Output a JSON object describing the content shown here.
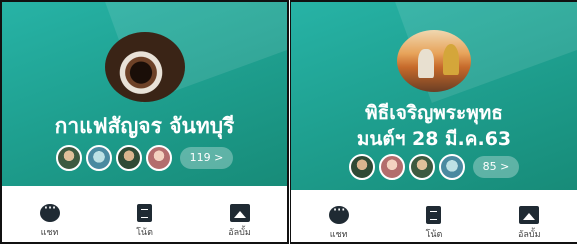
{
  "left": {
    "title": "กาแฟสัญจร จันทบุรี",
    "members_badge": "119 >",
    "avatar_icon": "coffee-photo",
    "actions": [
      {
        "label": "แชท",
        "icon": "chat-icon"
      },
      {
        "label": "โน้ต",
        "icon": "note-icon"
      },
      {
        "label": "อัลบั้ม",
        "icon": "album-icon"
      }
    ]
  },
  "right": {
    "title_line1": "พิธีเจริญพระพุทธ",
    "title_line2": "มนต์ฯ 28 มี.ค.63",
    "members_badge": "85 >",
    "avatar_icon": "ceremony-photo",
    "actions": [
      {
        "label": "แชท",
        "icon": "chat-icon"
      },
      {
        "label": "โน้ต",
        "icon": "note-icon"
      },
      {
        "label": "อัลบั้ม",
        "icon": "album-icon"
      }
    ]
  },
  "colors": {
    "header_teal": "#1fa191",
    "icon_dark": "#1f2a33"
  }
}
